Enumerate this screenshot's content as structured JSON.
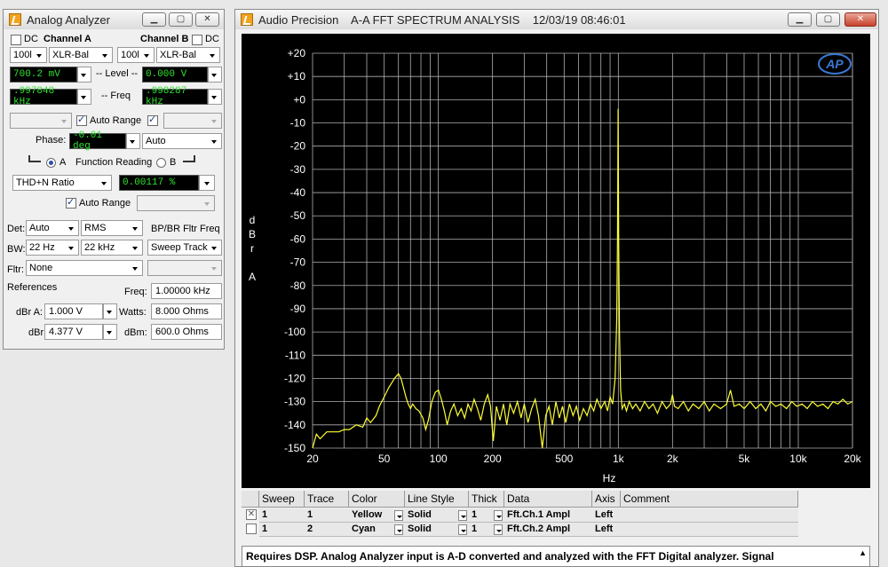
{
  "analyzer": {
    "title": "Analog Analyzer",
    "dc_label": "DC",
    "channel_a": "Channel A",
    "channel_b": "Channel B",
    "range_a": "100l",
    "input_a": "XLR-Bal",
    "range_b": "100l",
    "input_b": "XLR-Bal",
    "level_label": "-- Level --",
    "level_a": "700.2  mV",
    "level_b": "0.000   V",
    "freq_label": "-- Freq",
    "freq_a": ".997848 kHz",
    "freq_b": ".998287 kHz",
    "auto_range": "Auto Range",
    "phase_label": "Phase:",
    "phase_value": "-0.01  deg",
    "phase_mode": "Auto",
    "radio_a": "A",
    "function_reading": "Function Reading",
    "radio_b": "B",
    "function_type": "THD+N Ratio",
    "function_value": "0.00117  %",
    "auto_range2": "Auto Range",
    "det_label": "Det:",
    "det_value": "Auto",
    "det_mode": "RMS",
    "bp_label": "BP/BR Fltr Freq",
    "bw_label": "BW:",
    "bw_low": "22 Hz",
    "bw_high": "22 kHz",
    "bw_track": "Sweep Track",
    "fltr_label": "Fltr:",
    "fltr_value": "None",
    "references": "References",
    "ref_freq_label": "Freq:",
    "ref_freq": "1.00000 kHz",
    "dbra_label": "dBr A:",
    "dbra_value": "1.000    V",
    "watts_label": "Watts:",
    "watts_value": "8.000    Ohms",
    "dbr_label": "dBr",
    "dbr_value": "4.377    V",
    "dbm_label": "dBm:",
    "dbm_value": "600.0    Ohms"
  },
  "graph": {
    "title": "Audio Precision    A-A FFT SPECTRUM ANALYSIS    12/03/19 08:46:01",
    "logo": "AP",
    "ylabel_lines": [
      "d",
      "B",
      "r",
      "",
      "A"
    ],
    "xlabel": "Hz"
  },
  "chart_data": {
    "type": "line",
    "xscale": "log",
    "xlim": [
      20,
      20000
    ],
    "ylim": [
      -150,
      20
    ],
    "yticks": [
      20,
      10,
      0,
      -10,
      -20,
      -30,
      -40,
      -50,
      -60,
      -70,
      -80,
      -90,
      -100,
      -110,
      -120,
      -130,
      -140,
      -150
    ],
    "ytick_labels": [
      "+20",
      "+10",
      "+0",
      "-10",
      "-20",
      "-30",
      "-40",
      "-50",
      "-60",
      "-70",
      "-80",
      "-90",
      "-100",
      "-110",
      "-120",
      "-130",
      "-140",
      "-150"
    ],
    "xticks": [
      20,
      50,
      100,
      200,
      500,
      1000,
      2000,
      5000,
      10000,
      20000
    ],
    "xtick_labels": [
      "20",
      "50",
      "100",
      "200",
      "500",
      "1k",
      "2k",
      "5k",
      "10k",
      "20k"
    ],
    "grid": true,
    "colors": {
      "background": "#000000",
      "grid": "#b0b0b0",
      "trace": "#ffff33"
    },
    "series": [
      {
        "points": [
          [
            20,
            -150
          ],
          [
            21,
            -144
          ],
          [
            22,
            -146
          ],
          [
            24,
            -143
          ],
          [
            26,
            -143
          ],
          [
            28,
            -143
          ],
          [
            30,
            -142
          ],
          [
            32,
            -142
          ],
          [
            35,
            -140
          ],
          [
            38,
            -141
          ],
          [
            40,
            -137
          ],
          [
            42,
            -139
          ],
          [
            45,
            -136
          ],
          [
            47,
            -132
          ],
          [
            50,
            -128
          ],
          [
            53,
            -124
          ],
          [
            55,
            -122
          ],
          [
            57,
            -120
          ],
          [
            60,
            -118
          ],
          [
            62,
            -120
          ],
          [
            64,
            -124
          ],
          [
            66,
            -128
          ],
          [
            68,
            -131
          ],
          [
            70,
            -133
          ],
          [
            72,
            -131
          ],
          [
            75,
            -133
          ],
          [
            78,
            -134
          ],
          [
            82,
            -137
          ],
          [
            85,
            -142
          ],
          [
            88,
            -138
          ],
          [
            92,
            -130
          ],
          [
            96,
            -126
          ],
          [
            100,
            -125
          ],
          [
            104,
            -129
          ],
          [
            108,
            -134
          ],
          [
            112,
            -140
          ],
          [
            117,
            -134
          ],
          [
            122,
            -131
          ],
          [
            128,
            -136
          ],
          [
            134,
            -133
          ],
          [
            140,
            -137
          ],
          [
            146,
            -131
          ],
          [
            152,
            -134
          ],
          [
            158,
            -129
          ],
          [
            165,
            -133
          ],
          [
            172,
            -138
          ],
          [
            180,
            -131
          ],
          [
            188,
            -127
          ],
          [
            195,
            -132
          ],
          [
            202,
            -147
          ],
          [
            210,
            -132
          ],
          [
            220,
            -138
          ],
          [
            230,
            -131
          ],
          [
            240,
            -140
          ],
          [
            250,
            -131
          ],
          [
            262,
            -135
          ],
          [
            275,
            -130
          ],
          [
            288,
            -137
          ],
          [
            300,
            -131
          ],
          [
            315,
            -139
          ],
          [
            330,
            -133
          ],
          [
            345,
            -129
          ],
          [
            360,
            -136
          ],
          [
            378,
            -150
          ],
          [
            395,
            -136
          ],
          [
            412,
            -132
          ],
          [
            430,
            -140
          ],
          [
            450,
            -130
          ],
          [
            470,
            -137
          ],
          [
            490,
            -132
          ],
          [
            510,
            -139
          ],
          [
            535,
            -131
          ],
          [
            560,
            -136
          ],
          [
            585,
            -132
          ],
          [
            610,
            -138
          ],
          [
            640,
            -133
          ],
          [
            670,
            -136
          ],
          [
            700,
            -131
          ],
          [
            730,
            -134
          ],
          [
            760,
            -129
          ],
          [
            800,
            -133
          ],
          [
            840,
            -130
          ],
          [
            870,
            -134
          ],
          [
            900,
            -128
          ],
          [
            930,
            -131
          ],
          [
            960,
            -120
          ],
          [
            980,
            -95
          ],
          [
            990,
            -60
          ],
          [
            997,
            -4
          ],
          [
            1004,
            -60
          ],
          [
            1015,
            -100
          ],
          [
            1030,
            -125
          ],
          [
            1050,
            -133
          ],
          [
            1080,
            -131
          ],
          [
            1110,
            -134
          ],
          [
            1150,
            -130
          ],
          [
            1200,
            -133
          ],
          [
            1250,
            -131
          ],
          [
            1320,
            -134
          ],
          [
            1400,
            -130
          ],
          [
            1480,
            -133
          ],
          [
            1560,
            -131
          ],
          [
            1650,
            -135
          ],
          [
            1750,
            -130
          ],
          [
            1850,
            -133
          ],
          [
            1950,
            -131
          ],
          [
            2000,
            -127
          ],
          [
            2050,
            -132
          ],
          [
            2150,
            -133
          ],
          [
            2300,
            -130
          ],
          [
            2450,
            -134
          ],
          [
            2600,
            -131
          ],
          [
            2800,
            -133
          ],
          [
            3000,
            -130
          ],
          [
            3200,
            -134
          ],
          [
            3400,
            -131
          ],
          [
            3700,
            -133
          ],
          [
            4000,
            -131
          ],
          [
            4200,
            -125
          ],
          [
            4400,
            -132
          ],
          [
            4700,
            -131
          ],
          [
            5000,
            -133
          ],
          [
            5400,
            -130
          ],
          [
            5800,
            -133
          ],
          [
            6200,
            -131
          ],
          [
            6600,
            -134
          ],
          [
            7000,
            -130
          ],
          [
            7500,
            -132
          ],
          [
            8000,
            -131
          ],
          [
            8600,
            -133
          ],
          [
            9200,
            -130
          ],
          [
            9800,
            -132
          ],
          [
            10500,
            -131
          ],
          [
            11200,
            -133
          ],
          [
            12000,
            -130
          ],
          [
            12800,
            -132
          ],
          [
            13700,
            -131
          ],
          [
            14600,
            -133
          ],
          [
            15600,
            -130
          ],
          [
            16600,
            -131
          ],
          [
            17700,
            -129
          ],
          [
            18800,
            -131
          ],
          [
            20000,
            -130
          ]
        ]
      }
    ]
  },
  "table": {
    "headers": [
      "Sweep",
      "Trace",
      "Color",
      "Line Style",
      "Thick",
      "Data",
      "Axis",
      "Comment"
    ],
    "rows": [
      {
        "sweep": "1",
        "trace": "1",
        "color": "Yellow",
        "style": "Solid",
        "thick": "1",
        "data": "Fft.Ch.1 Ampl",
        "axis": "Left",
        "checked": true
      },
      {
        "sweep": "1",
        "trace": "2",
        "color": "Cyan",
        "style": "Solid",
        "thick": "1",
        "data": "Fft.Ch.2 Ampl",
        "axis": "Left",
        "checked": false
      }
    ]
  },
  "comment": "Requires DSP.  Analog Analyzer input is A-D converted and analyzed with the FFT Digital analyzer.  Signal"
}
